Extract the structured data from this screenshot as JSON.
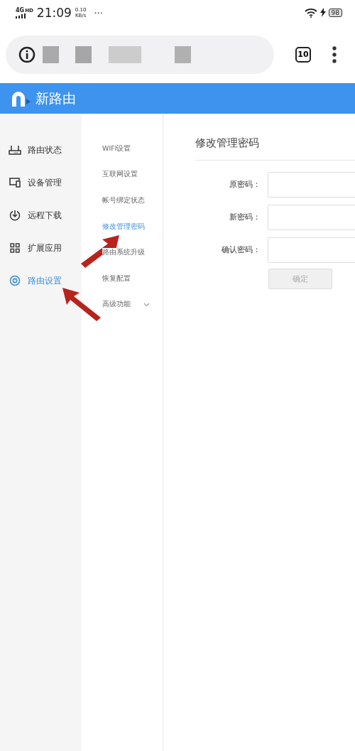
{
  "status_bar": {
    "network": "4G",
    "network_badge": "HD",
    "time": "21:09",
    "speed": "0.10",
    "speed_unit": "KB/s",
    "more": "···",
    "battery": "98",
    "charging": true
  },
  "browser": {
    "tab_count": "10"
  },
  "header": {
    "title": "新路由"
  },
  "sidebar": {
    "items": [
      {
        "label": "路由状态",
        "selected": false
      },
      {
        "label": "设备管理",
        "selected": false
      },
      {
        "label": "远程下载",
        "selected": false
      },
      {
        "label": "扩展应用",
        "selected": false
      },
      {
        "label": "路由设置",
        "selected": true
      }
    ]
  },
  "submenu": {
    "items": [
      {
        "label": "WIFI设置",
        "selected": false
      },
      {
        "label": "互联网设置",
        "selected": false
      },
      {
        "label": "帐号绑定状态",
        "selected": false
      },
      {
        "label": "修改管理密码",
        "selected": true
      },
      {
        "label": "路由系统升级",
        "selected": false
      },
      {
        "label": "恢复配置",
        "selected": false
      },
      {
        "label": "高级功能",
        "selected": false,
        "expandable": true
      }
    ]
  },
  "pointer_arrows": [
    {
      "kind": "up-right"
    },
    {
      "kind": "up-left"
    }
  ],
  "form": {
    "title": "修改管理密码",
    "fields": [
      {
        "label": "原密码："
      },
      {
        "label": "新密码："
      },
      {
        "label": "确认密码："
      }
    ],
    "submit": {
      "label": "确定",
      "disabled": true
    }
  }
}
